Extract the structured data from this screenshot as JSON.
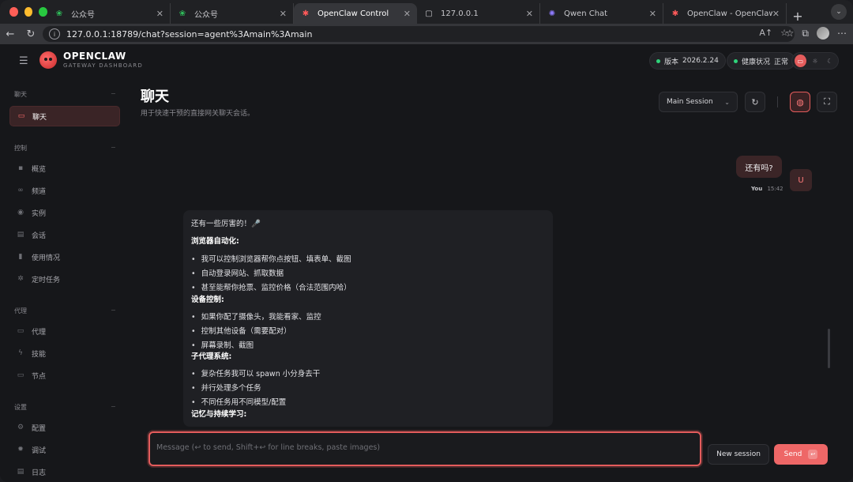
{
  "browser": {
    "tabs": [
      {
        "label": "公众号",
        "icon": "wechat-icon"
      },
      {
        "label": "公众号",
        "icon": "wechat-icon"
      },
      {
        "label": "OpenClaw Control",
        "icon": "openclaw-icon",
        "active": true
      },
      {
        "label": "127.0.0.1",
        "icon": "page-icon"
      },
      {
        "label": "Qwen Chat",
        "icon": "qwen-icon"
      },
      {
        "label": "OpenClaw - OpenClaw",
        "icon": "openclaw-icon"
      }
    ],
    "url": "127.0.0.1:18789/chat?session=agent%3Amain%3Amain",
    "url_right": "A↑"
  },
  "app": {
    "brand_name": "OPENCLAW",
    "brand_sub": "GATEWAY DASHBOARD",
    "version_label": "版本",
    "version_value": "2026.2.24",
    "health_label": "健康状况",
    "health_value": "正常"
  },
  "sidebar": {
    "sections": [
      {
        "title": "聊天",
        "items": [
          {
            "label": "聊天",
            "icon": "chat-icon",
            "active": true
          }
        ]
      },
      {
        "title": "控制",
        "items": [
          {
            "label": "概览",
            "icon": "bar-chart-icon"
          },
          {
            "label": "频道",
            "icon": "link-icon"
          },
          {
            "label": "实例",
            "icon": "broadcast-icon"
          },
          {
            "label": "会话",
            "icon": "document-icon"
          },
          {
            "label": "使用情况",
            "icon": "usage-icon"
          },
          {
            "label": "定时任务",
            "icon": "sun-icon"
          }
        ]
      },
      {
        "title": "代理",
        "items": [
          {
            "label": "代理",
            "icon": "folder-icon"
          },
          {
            "label": "技能",
            "icon": "bolt-icon"
          },
          {
            "label": "节点",
            "icon": "monitor-icon"
          }
        ]
      },
      {
        "title": "设置",
        "items": [
          {
            "label": "配置",
            "icon": "gear-icon"
          },
          {
            "label": "调试",
            "icon": "bug-icon"
          },
          {
            "label": "日志",
            "icon": "log-icon"
          }
        ]
      }
    ]
  },
  "main": {
    "title": "聊天",
    "subtitle": "用于快速干预的直接网关聊天会话。",
    "session_selected": "Main Session"
  },
  "chat": {
    "user_message": "还有吗?",
    "user_avatar": "U",
    "user_name": "You",
    "user_time": "15:42",
    "bot_lines": [
      {
        "text": "还有一些厉害的！🎤",
        "kind": "text"
      },
      {
        "text": "浏览器自动化:",
        "kind": "heading"
      },
      {
        "text": "我可以控制浏览器帮你点按钮、填表单、截图",
        "kind": "bullet"
      },
      {
        "text": "自动登录网站、抓取数据",
        "kind": "bullet"
      },
      {
        "text": "甚至能帮你抢票、监控价格（合法范围内哈）",
        "kind": "bullet"
      },
      {
        "text": "设备控制:",
        "kind": "heading"
      },
      {
        "text": "如果你配了摄像头，我能看家、监控",
        "kind": "bullet"
      },
      {
        "text": "控制其他设备（需要配对）",
        "kind": "bullet"
      },
      {
        "text": "屏幕录制、截图",
        "kind": "bullet"
      },
      {
        "text": "子代理系统:",
        "kind": "heading"
      },
      {
        "text": "复杂任务我可以 spawn 小分身去干",
        "kind": "bullet"
      },
      {
        "text": "并行处理多个任务",
        "kind": "bullet"
      },
      {
        "text": "不同任务用不同模型/配置",
        "kind": "bullet"
      },
      {
        "text": "记忆与持续学习:",
        "kind": "heading"
      }
    ]
  },
  "composer": {
    "placeholder": "Message (↩ to send, Shift+↩ for line breaks, paste images)",
    "new_session_label": "New session",
    "send_label": "Send",
    "send_kbd": "↩"
  },
  "colors": {
    "accent": "#e45c5c",
    "health_dot": "#2fd37a"
  }
}
